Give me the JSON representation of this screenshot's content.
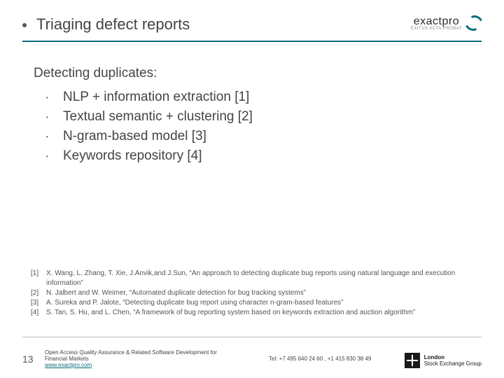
{
  "header": {
    "title": "Triaging defect reports",
    "logo_text": "exactpro",
    "logo_sub": "EXITUS ACTA PROBAT"
  },
  "body": {
    "headline": "Detecting duplicates:",
    "items": [
      "NLP + information extraction [1]",
      "Textual semantic + clustering [2]",
      "N-gram-based model [3]",
      "Keywords repository [4]"
    ]
  },
  "refs": [
    {
      "n": "[1]",
      "t": "X. Wang, L. Zhang, T. Xie, J.Anvik,and J.Sun, “An approach to detecting duplicate bug reports using natural language and execution information”"
    },
    {
      "n": "[2]",
      "t": "N. Jalbert and W. Weimer, “Automated duplicate detection for bug tracking systems”"
    },
    {
      "n": "[3]",
      "t": "A. Sureka and P. Jalote, “Detecting duplicate bug report using character n-gram-based features”"
    },
    {
      "n": "[4]",
      "t": "S. Tan, S. Hu, and L. Chen, “A framework of bug reporting system based on keywords extraction and auction algorithm”"
    }
  ],
  "footer": {
    "page": "13",
    "line1": "Open Access Quality Assurance & Related Software Development for Financial Markets",
    "url": "www.exactpro.com",
    "tel": "Tel: +7 495 640 24 60 ,  +1 415 830 38 49",
    "lse1": "London",
    "lse2": "Stock Exchange Group"
  }
}
